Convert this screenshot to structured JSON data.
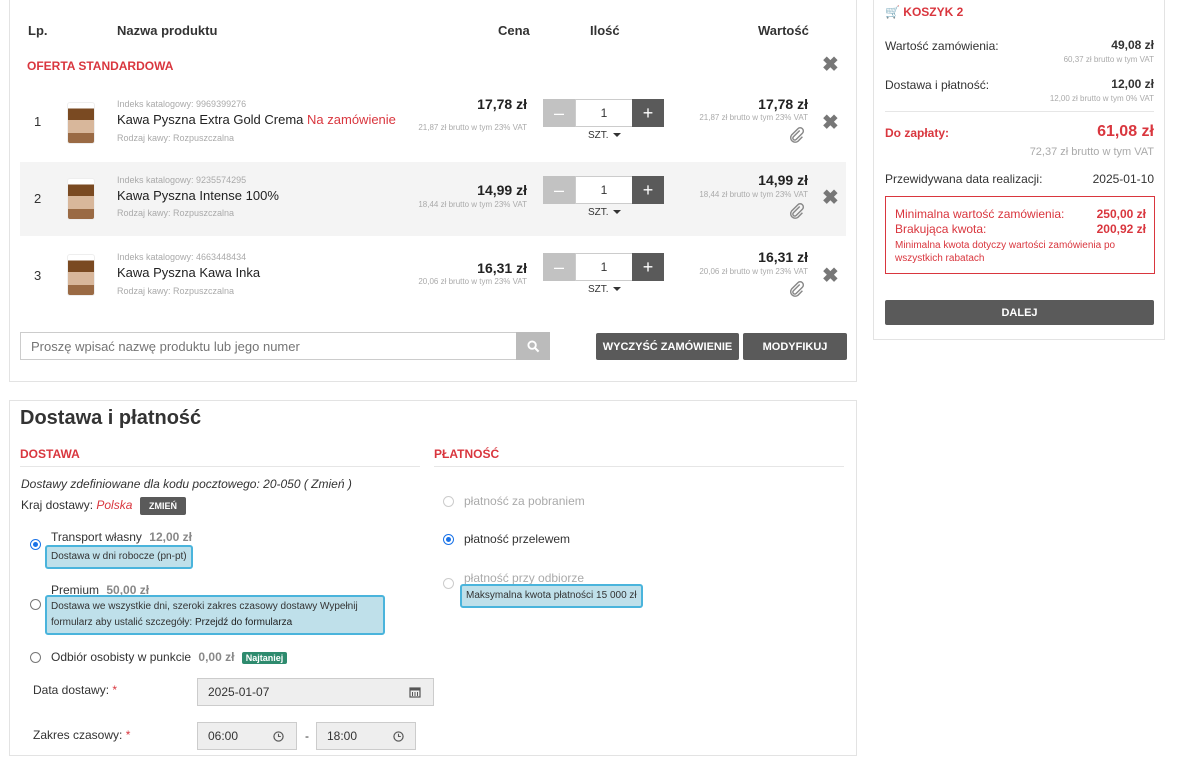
{
  "table": {
    "headers": {
      "lp": "Lp.",
      "name": "Nazwa produktu",
      "price": "Cena",
      "qty": "Ilość",
      "value": "Wartość"
    },
    "section_title": "OFERTA STANDARDOWA",
    "rows": [
      {
        "lp": "1",
        "index": "Indeks katalogowy: 9969399276",
        "name": "Kawa Pyszna Extra Gold Crema",
        "tag": "Na zamówienie",
        "attr": "Rodzaj kawy: Rozpuszczalna",
        "price": "17,78 zł",
        "price_vat": "21,87 zł brutto w tym 23% VAT",
        "qty": "1",
        "unit": "SZT.",
        "value": "17,78 zł",
        "value_vat": "21,87 zł brutto w tym 23% VAT"
      },
      {
        "lp": "2",
        "index": "Indeks katalogowy: 9235574295",
        "name": "Kawa Pyszna Intense 100%",
        "tag": "",
        "attr": "Rodzaj kawy: Rozpuszczalna",
        "price": "14,99 zł",
        "price_vat": "18,44 zł brutto w tym 23% VAT",
        "qty": "1",
        "unit": "SZT.",
        "value": "14,99 zł",
        "value_vat": "18,44 zł brutto w tym 23% VAT"
      },
      {
        "lp": "3",
        "index": "Indeks katalogowy: 4663448434",
        "name": "Kawa Pyszna Kawa Inka",
        "tag": "",
        "attr": "Rodzaj kawy: Rozpuszczalna",
        "price": "16,31 zł",
        "price_vat": "20,06 zł brutto w tym 23% VAT",
        "qty": "1",
        "unit": "SZT.",
        "value": "16,31 zł",
        "value_vat": "20,06 zł brutto w tym 23% VAT"
      }
    ]
  },
  "search": {
    "placeholder": "Proszę wpisać nazwę produktu lub jego numer"
  },
  "actions": {
    "clear": "WYCZYŚĆ ZAMÓWIENIE",
    "modify": "MODYFIKUJ"
  },
  "cart": {
    "title": "KOSZYK 2",
    "order_value_label": "Wartość zamówienia:",
    "order_value": "49,08 zł",
    "order_value_vat": "60,37 zł brutto w tym VAT",
    "delivery_label": "Dostawa i płatność:",
    "delivery_value": "12,00 zł",
    "delivery_vat": "12,00 zł brutto w tym 0% VAT",
    "topay_label": "Do zapłaty:",
    "topay_value": "61,08 zł",
    "topay_vat": "72,37 zł brutto w tym VAT",
    "date_label": "Przewidywana data realizacji:",
    "date_value": "2025-01-10",
    "min_label": "Minimalna wartość zamówienia:",
    "min_value": "250,00 zł",
    "missing_label": "Brakująca kwota:",
    "missing_value": "200,92 zł",
    "min_note": "Minimalna kwota dotyczy wartości zamówienia po wszystkich rabatach",
    "next_button": "DALEJ"
  },
  "delivery": {
    "title": "Dostawa i płatność",
    "section": "DOSTAWA",
    "postcode_text": "Dostawy zdefiniowane dla kodu pocztowego: 20-050 ( Zmień )",
    "country_label": "Kraj dostawy:",
    "country": "Polska",
    "change_button": "ZMIEŃ",
    "options": [
      {
        "name": "Transport własny",
        "price": "12,00 zł",
        "desc": "Dostawa w dni robocze (pn-pt)"
      },
      {
        "name": "Premium",
        "price": "50,00 zł",
        "desc": "Dostawa we wszystkie dni, szeroki zakres czasowy dostawy Wypełnij formularz aby ustalić szczegóły:",
        "link": "Przejdź do formularza"
      },
      {
        "name": "Odbiór osobisty w punkcie",
        "price": "0,00 zł",
        "badge": "Najtaniej"
      }
    ],
    "date_label": "Data dostawy:",
    "date_value": "2025-01-07",
    "time_label": "Zakres czasowy:",
    "time_from": "06:00",
    "time_sep": "-",
    "time_to": "18:00",
    "required": "*"
  },
  "payment": {
    "section": "PŁATNOŚĆ",
    "options": [
      {
        "name": "płatność za pobraniem"
      },
      {
        "name": "płatność przelewem"
      },
      {
        "name": "płatność przy odbiorze",
        "desc": "Maksymalna kwota płatności 15 000 zł"
      }
    ]
  },
  "colors": {
    "accent": "#d9363e",
    "dark_button": "#5a5a5a",
    "highlight": "#bfe0ea",
    "badge": "#2e8b6e"
  }
}
